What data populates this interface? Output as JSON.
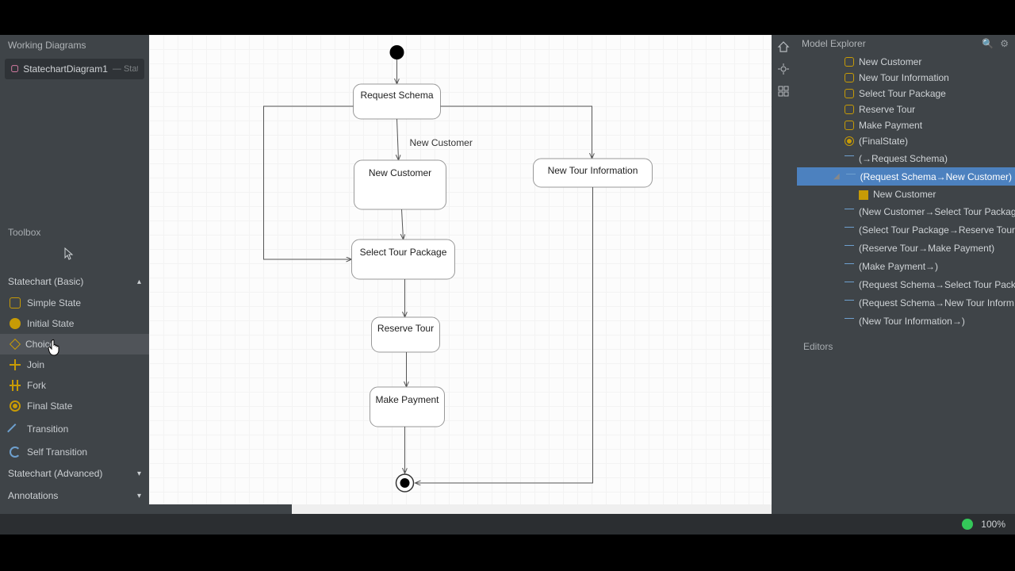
{
  "left": {
    "working_title": "Working Diagrams",
    "tab_label": "StatechartDiagram1",
    "tab_suffix": "— StateM",
    "toolbox_title": "Toolbox",
    "sections": {
      "basic": {
        "label": "Statechart (Basic)",
        "expanded": true
      },
      "advanced": {
        "label": "Statechart (Advanced)",
        "expanded": false
      },
      "annotations": {
        "label": "Annotations",
        "expanded": false
      }
    },
    "tools": {
      "simple_state": "Simple State",
      "initial_state": "Initial State",
      "choice": "Choice",
      "join": "Join",
      "fork": "Fork",
      "final_state": "Final State",
      "transition": "Transition",
      "self_transition": "Self Transition"
    }
  },
  "canvas": {
    "nodes": {
      "request_schema": "Request Schema",
      "new_customer": "New Customer",
      "new_tour_info": "New Tour Information",
      "select_tour_package": "Select Tour Package",
      "reserve_tour": "Reserve Tour",
      "make_payment": "Make Payment"
    },
    "labels": {
      "new_customer_edge": "New Customer"
    }
  },
  "right": {
    "panel_title": "Model Explorer",
    "editors_title": "Editors",
    "items": {
      "n1": "New Customer",
      "n2": "New Tour Information",
      "n3": "Select Tour Package",
      "n4": "Reserve Tour",
      "n5": "Make Payment",
      "n6": "(FinalState)",
      "n7": "(→Request Schema)",
      "n8": "(Request Schema→New Customer)",
      "n8a": "New Customer",
      "n9": "(New Customer→Select Tour Packag",
      "n10": "(Select Tour Package→Reserve Tour",
      "n11": "(Reserve Tour→Make Payment)",
      "n12": "(Make Payment→)",
      "n13": "(Request Schema→Select Tour Pack",
      "n14": "(Request Schema→New Tour Inform",
      "n15": "(New Tour Information→)"
    }
  },
  "status": {
    "zoom": "100%"
  }
}
